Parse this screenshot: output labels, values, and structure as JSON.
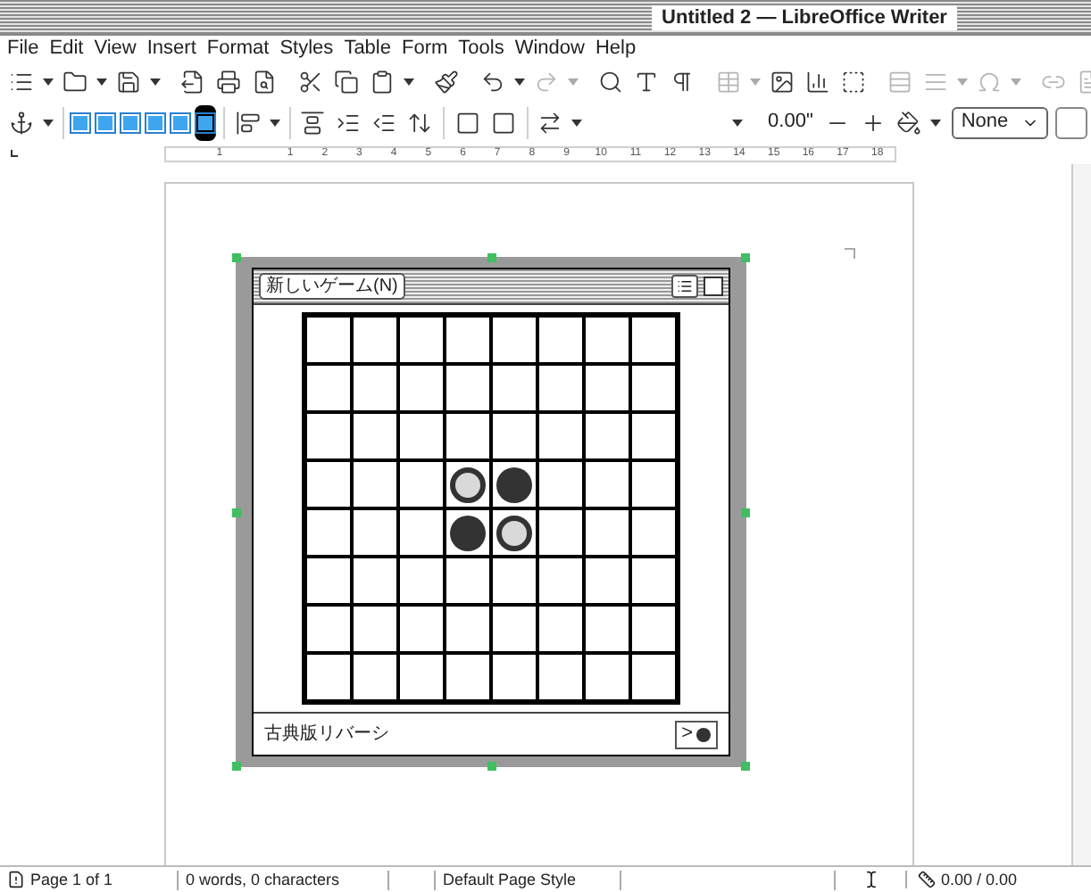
{
  "window": {
    "title": "Untitled 2 — LibreOffice Writer"
  },
  "menu": [
    "File",
    "Edit",
    "View",
    "Insert",
    "Format",
    "Styles",
    "Table",
    "Form",
    "Tools",
    "Window",
    "Help"
  ],
  "toolbar": {
    "spacing_value": "0.00\"",
    "style_select": "None"
  },
  "ruler": {
    "labels": [
      "1",
      "1",
      "2",
      "3",
      "4",
      "5",
      "6",
      "7",
      "8",
      "9",
      "10",
      "11",
      "12",
      "13",
      "14",
      "15",
      "16",
      "17",
      "18"
    ]
  },
  "embedded_window": {
    "menu_button": "新しいゲーム(N)",
    "board": [
      [
        {
          "kind": "empty"
        },
        {
          "kind": "empty"
        },
        {
          "kind": "empty"
        },
        {
          "kind": "empty"
        },
        {
          "kind": "empty"
        },
        {
          "kind": "empty"
        },
        {
          "kind": "empty"
        },
        {
          "kind": "empty"
        }
      ],
      [
        {
          "kind": "empty"
        },
        {
          "kind": "empty"
        },
        {
          "kind": "empty"
        },
        {
          "kind": "empty"
        },
        {
          "kind": "empty"
        },
        {
          "kind": "empty"
        },
        {
          "kind": "empty"
        },
        {
          "kind": "empty"
        }
      ],
      [
        {
          "kind": "empty"
        },
        {
          "kind": "empty"
        },
        {
          "kind": "empty"
        },
        {
          "kind": "empty"
        },
        {
          "kind": "empty"
        },
        {
          "kind": "empty"
        },
        {
          "kind": "empty"
        },
        {
          "kind": "empty"
        }
      ],
      [
        {
          "kind": "empty"
        },
        {
          "kind": "empty"
        },
        {
          "kind": "empty"
        },
        {
          "kind": "light"
        },
        {
          "kind": "dark"
        },
        {
          "kind": "empty"
        },
        {
          "kind": "empty"
        },
        {
          "kind": "empty"
        }
      ],
      [
        {
          "kind": "empty"
        },
        {
          "kind": "empty"
        },
        {
          "kind": "empty"
        },
        {
          "kind": "dark"
        },
        {
          "kind": "light"
        },
        {
          "kind": "empty"
        },
        {
          "kind": "empty"
        },
        {
          "kind": "empty"
        }
      ],
      [
        {
          "kind": "empty"
        },
        {
          "kind": "empty"
        },
        {
          "kind": "empty"
        },
        {
          "kind": "empty"
        },
        {
          "kind": "empty"
        },
        {
          "kind": "empty"
        },
        {
          "kind": "empty"
        },
        {
          "kind": "empty"
        }
      ],
      [
        {
          "kind": "empty"
        },
        {
          "kind": "empty"
        },
        {
          "kind": "empty"
        },
        {
          "kind": "empty"
        },
        {
          "kind": "empty"
        },
        {
          "kind": "empty"
        },
        {
          "kind": "empty"
        },
        {
          "kind": "empty"
        }
      ],
      [
        {
          "kind": "empty"
        },
        {
          "kind": "empty"
        },
        {
          "kind": "empty"
        },
        {
          "kind": "empty"
        },
        {
          "kind": "empty"
        },
        {
          "kind": "empty"
        },
        {
          "kind": "empty"
        },
        {
          "kind": "empty"
        }
      ]
    ],
    "status": "古典版リバーシ",
    "next_button": ">"
  },
  "status_bar": {
    "page": "Page 1 of 1",
    "words": "0 words, 0 characters",
    "page_style": "Default Page Style",
    "position": "0.00 / 0.00"
  }
}
